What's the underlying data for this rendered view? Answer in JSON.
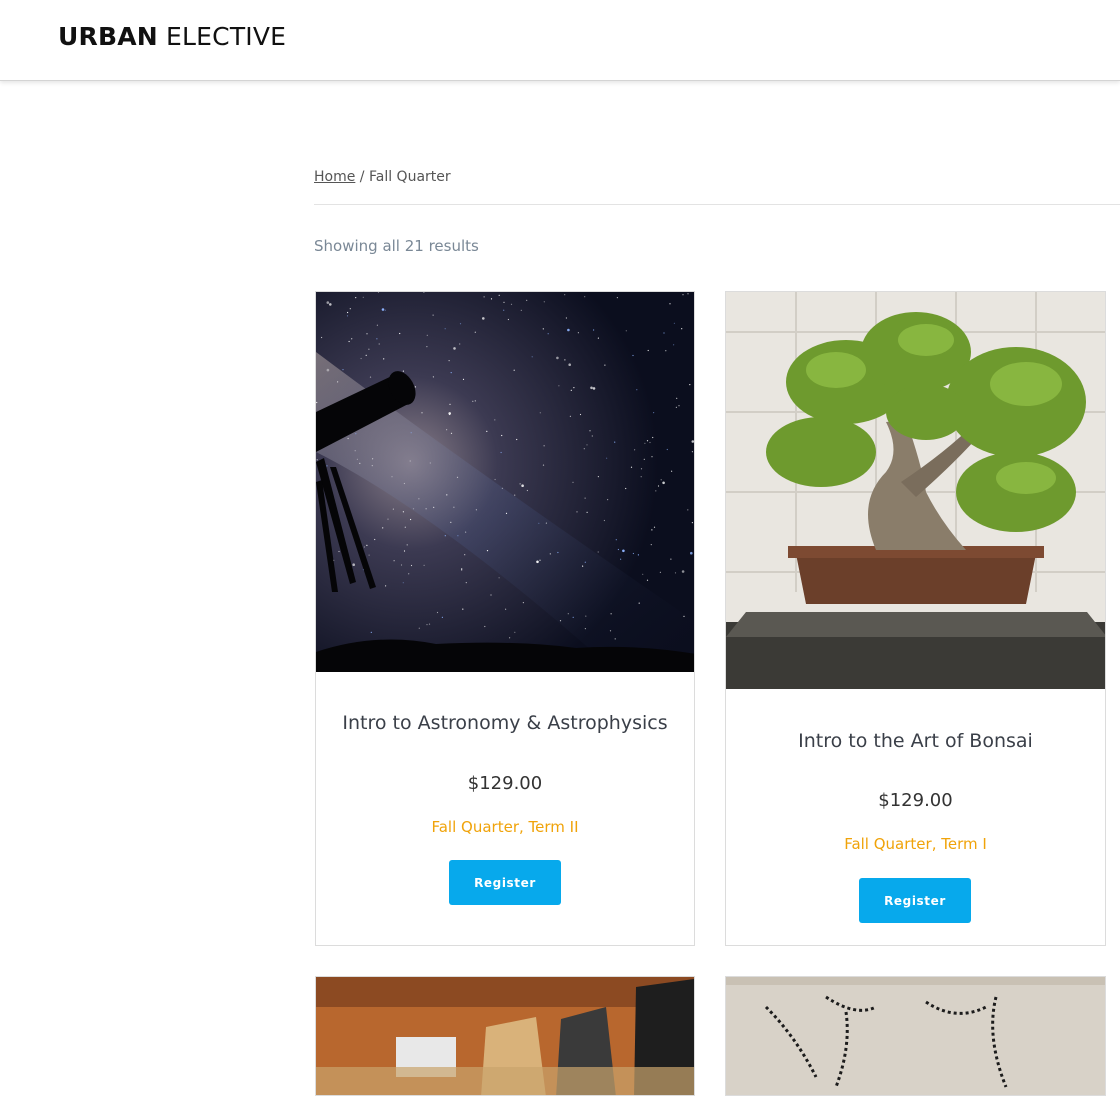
{
  "brand": {
    "logo_bold": "URBAN",
    "logo_light": "ELECTIVE"
  },
  "breadcrumb": {
    "home": "Home",
    "separator": " / ",
    "current": "Fall Quarter"
  },
  "result_count": "Showing all 21 results",
  "colors": {
    "accent_orange": "#f0a30a",
    "button_blue": "#07a9ec"
  },
  "products": [
    {
      "title": "Intro to Astronomy & Astrophysics",
      "price": "$129.00",
      "categories": [
        "Fall Quarter",
        "Term II"
      ],
      "button": "Register",
      "image": "night-sky-telescope-image"
    },
    {
      "title": "Intro to the Art of Bonsai",
      "price": "$129.00",
      "categories": [
        "Fall Quarter",
        "Term I"
      ],
      "button": "Register",
      "image": "bonsai-tree-image"
    },
    {
      "image": "microgreens-market-image"
    },
    {
      "image": "embroidery-canvas-image"
    }
  ]
}
